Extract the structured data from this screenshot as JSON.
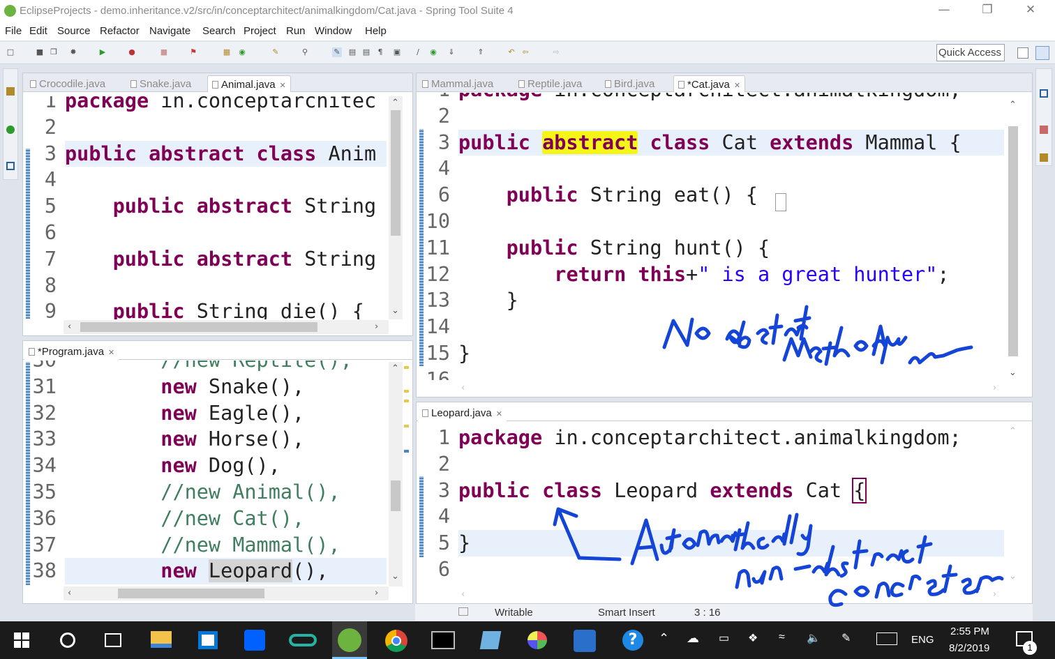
{
  "window": {
    "title": "EclipseProjects - demo.inheritance.v2/src/in/conceptarchitect/animalkingdom/Cat.java - Spring Tool Suite 4"
  },
  "menu": [
    "File",
    "Edit",
    "Source",
    "Refactor",
    "Navigate",
    "Search",
    "Project",
    "Run",
    "Window",
    "Help"
  ],
  "toolbar": {
    "quick_access": "Quick Access"
  },
  "left_top": {
    "tabs": [
      {
        "label": "Crocodile.java",
        "active": false
      },
      {
        "label": "Snake.java",
        "active": false
      },
      {
        "label": "Animal.java",
        "active": true
      }
    ],
    "lines": [
      {
        "n": "1",
        "t": [
          [
            "kw",
            "package "
          ],
          [
            "",
            "in.conceptarchitec"
          ]
        ]
      },
      {
        "n": "2",
        "t": []
      },
      {
        "n": "3",
        "t": [
          [
            "kw",
            "public abstract class "
          ],
          [
            "",
            "Anim"
          ]
        ],
        "hl": true
      },
      {
        "n": "4",
        "t": []
      },
      {
        "n": "5",
        "t": [
          [
            "",
            "    "
          ],
          [
            "kw",
            "public abstract "
          ],
          [
            "",
            "String"
          ]
        ]
      },
      {
        "n": "6",
        "t": []
      },
      {
        "n": "7",
        "t": [
          [
            "",
            "    "
          ],
          [
            "kw",
            "public abstract "
          ],
          [
            "",
            "String"
          ]
        ]
      },
      {
        "n": "8",
        "t": []
      },
      {
        "n": "9",
        "t": [
          [
            "",
            "    "
          ],
          [
            "kw",
            "public "
          ],
          [
            "",
            "String die() {"
          ]
        ]
      }
    ]
  },
  "right_top": {
    "tabs": [
      {
        "label": "Mammal.java",
        "active": false
      },
      {
        "label": "Reptile.java",
        "active": false
      },
      {
        "label": "Bird.java",
        "active": false
      },
      {
        "label": "*Cat.java",
        "active": true
      }
    ],
    "lines": [
      {
        "n": "1",
        "t": [
          [
            "kw",
            "package "
          ],
          [
            "",
            "in.conceptarchitect.animalkingdom;"
          ]
        ]
      },
      {
        "n": "2",
        "t": []
      },
      {
        "n": "3",
        "t": [
          [
            "kw",
            "public "
          ],
          [
            "mark",
            "abstract"
          ],
          [
            "kw",
            " class "
          ],
          [
            "",
            "Cat "
          ],
          [
            "kw",
            "extends "
          ],
          [
            "",
            "Mammal {"
          ]
        ],
        "hl": true
      },
      {
        "n": "4",
        "t": []
      },
      {
        "n": "6",
        "t": [
          [
            "",
            "    "
          ],
          [
            "kw",
            "public "
          ],
          [
            "",
            "String eat() {"
          ]
        ]
      },
      {
        "n": "10",
        "t": []
      },
      {
        "n": "11",
        "t": [
          [
            "",
            "    "
          ],
          [
            "kw",
            "public "
          ],
          [
            "",
            "String hunt() {"
          ]
        ]
      },
      {
        "n": "12",
        "t": [
          [
            "",
            "        "
          ],
          [
            "kw",
            "return this"
          ],
          [
            "",
            "+"
          ],
          [
            "str",
            "\" is a great hunter\""
          ],
          [
            "",
            ";"
          ]
        ]
      },
      {
        "n": "13",
        "t": [
          [
            "",
            "    }"
          ]
        ]
      },
      {
        "n": "14",
        "t": []
      },
      {
        "n": "15",
        "t": [
          [
            "",
            "}"
          ]
        ]
      },
      {
        "n": "16",
        "t": []
      }
    ]
  },
  "left_bottom": {
    "tabs": [
      {
        "label": "*Program.java",
        "active": true
      }
    ],
    "lines": [
      {
        "n": "30",
        "t": [
          [
            "",
            "        "
          ],
          [
            "cm",
            "//new Reptile(),"
          ]
        ]
      },
      {
        "n": "31",
        "t": [
          [
            "",
            "        "
          ],
          [
            "kw",
            "new "
          ],
          [
            "",
            "Snake(),"
          ]
        ]
      },
      {
        "n": "32",
        "t": [
          [
            "",
            "        "
          ],
          [
            "kw",
            "new "
          ],
          [
            "",
            "Eagle(),"
          ]
        ]
      },
      {
        "n": "33",
        "t": [
          [
            "",
            "        "
          ],
          [
            "kw",
            "new "
          ],
          [
            "",
            "Horse(),"
          ]
        ]
      },
      {
        "n": "34",
        "t": [
          [
            "",
            "        "
          ],
          [
            "kw",
            "new "
          ],
          [
            "",
            "Dog(),"
          ]
        ]
      },
      {
        "n": "35",
        "t": [
          [
            "",
            "        "
          ],
          [
            "cm",
            "//new Animal(),"
          ]
        ]
      },
      {
        "n": "36",
        "t": [
          [
            "",
            "        "
          ],
          [
            "cm",
            "//new Cat(),"
          ]
        ]
      },
      {
        "n": "37",
        "t": [
          [
            "",
            "        "
          ],
          [
            "cm",
            "//new Mammal(),"
          ]
        ]
      },
      {
        "n": "38",
        "t": [
          [
            "",
            "        "
          ],
          [
            "kw",
            "new "
          ],
          [
            "sel",
            "Leopard"
          ],
          [
            "",
            "(),"
          ]
        ],
        "hl": true
      }
    ]
  },
  "right_bottom": {
    "tabs": [
      {
        "label": "Leopard.java",
        "active": true
      }
    ],
    "lines": [
      {
        "n": "1",
        "t": [
          [
            "kw",
            "package "
          ],
          [
            "",
            "in.conceptarchitect.animalkingdom;"
          ]
        ]
      },
      {
        "n": "2",
        "t": []
      },
      {
        "n": "3",
        "t": [
          [
            "kw",
            "public class "
          ],
          [
            "",
            "Leopard "
          ],
          [
            "kw",
            "extends "
          ],
          [
            "",
            "Cat "
          ],
          [
            "box",
            "{"
          ]
        ]
      },
      {
        "n": "4",
        "t": []
      },
      {
        "n": "5",
        "t": [
          [
            "",
            "}"
          ]
        ],
        "hl": true
      },
      {
        "n": "6",
        "t": []
      }
    ]
  },
  "status": {
    "writable": "Writable",
    "insert": "Smart Insert",
    "position": "3 : 16"
  },
  "taskbar": {
    "time": "2:55 PM",
    "date": "8/2/2019",
    "lang": "ENG",
    "notifications": "1"
  },
  "annotations": {
    "note1": "No abstract method here",
    "note2": "Automatically non-abstract concrete"
  },
  "colors": {
    "keyword": "#7f0055",
    "string": "#2a00ff",
    "comment": "#3f7f5f",
    "ink": "#1545d6",
    "highlight": "#f5f51a"
  }
}
